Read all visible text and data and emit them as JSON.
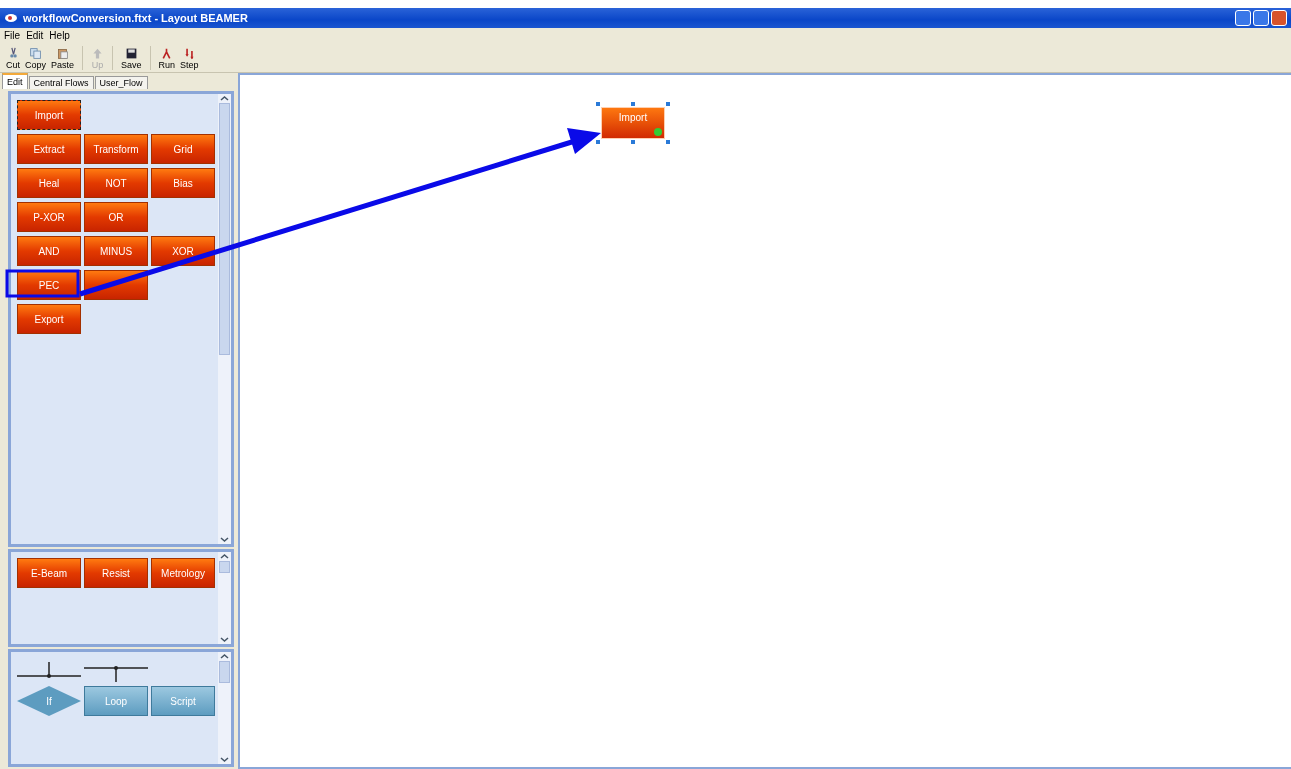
{
  "window": {
    "title": "workflowConversion.ftxt - Layout BEAMER"
  },
  "menu": [
    "File",
    "Edit",
    "Help"
  ],
  "toolbar": [
    {
      "kind": "cut",
      "label": "Cut",
      "disabled": false
    },
    {
      "kind": "copy",
      "label": "Copy",
      "disabled": false
    },
    {
      "kind": "paste",
      "label": "Paste",
      "disabled": false
    },
    {
      "kind": "up",
      "label": "Up",
      "disabled": true
    },
    {
      "kind": "save",
      "label": "Save",
      "disabled": false
    },
    {
      "kind": "run",
      "label": "Run",
      "disabled": false
    },
    {
      "kind": "step",
      "label": "Step",
      "disabled": false
    }
  ],
  "tabs": [
    {
      "label": "Edit",
      "selected": true
    },
    {
      "label": "Central Flows",
      "selected": false
    },
    {
      "label": "User_Flow",
      "selected": false
    }
  ],
  "palettes": [
    {
      "rows": [
        [
          {
            "kind": "op",
            "label": "Import",
            "selected": true
          }
        ],
        [
          {
            "kind": "op",
            "label": "Extract"
          },
          {
            "kind": "op",
            "label": "Transform"
          },
          {
            "kind": "op",
            "label": "Grid"
          }
        ],
        [
          {
            "kind": "op",
            "label": "Heal"
          },
          {
            "kind": "op",
            "label": "NOT"
          },
          {
            "kind": "op",
            "label": "Bias"
          }
        ],
        [
          {
            "kind": "op",
            "label": "P-XOR"
          },
          {
            "kind": "op",
            "label": "OR"
          }
        ],
        [
          {
            "kind": "op",
            "label": "AND"
          },
          {
            "kind": "op",
            "label": "MINUS"
          },
          {
            "kind": "op",
            "label": "XOR"
          }
        ],
        [
          {
            "kind": "op",
            "label": "PEC"
          },
          {
            "kind": "op"
          }
        ],
        [
          {
            "kind": "op",
            "label": "Export"
          }
        ]
      ]
    },
    {
      "rows": [
        [
          {
            "kind": "op",
            "label": "E-Beam"
          },
          {
            "kind": "op",
            "label": "Resist"
          },
          {
            "kind": "op",
            "label": "Metrology"
          }
        ]
      ]
    },
    {
      "rows": [
        [
          {
            "kind": "connector-below"
          },
          {
            "kind": "connector-above"
          }
        ],
        [
          {
            "kind": "decision",
            "label": "If"
          },
          {
            "kind": "flow",
            "label": "Loop"
          },
          {
            "kind": "flow",
            "label": "Script"
          }
        ]
      ]
    }
  ],
  "canvas": {
    "nodes": [
      {
        "label": "Import",
        "selected": true
      }
    ]
  }
}
